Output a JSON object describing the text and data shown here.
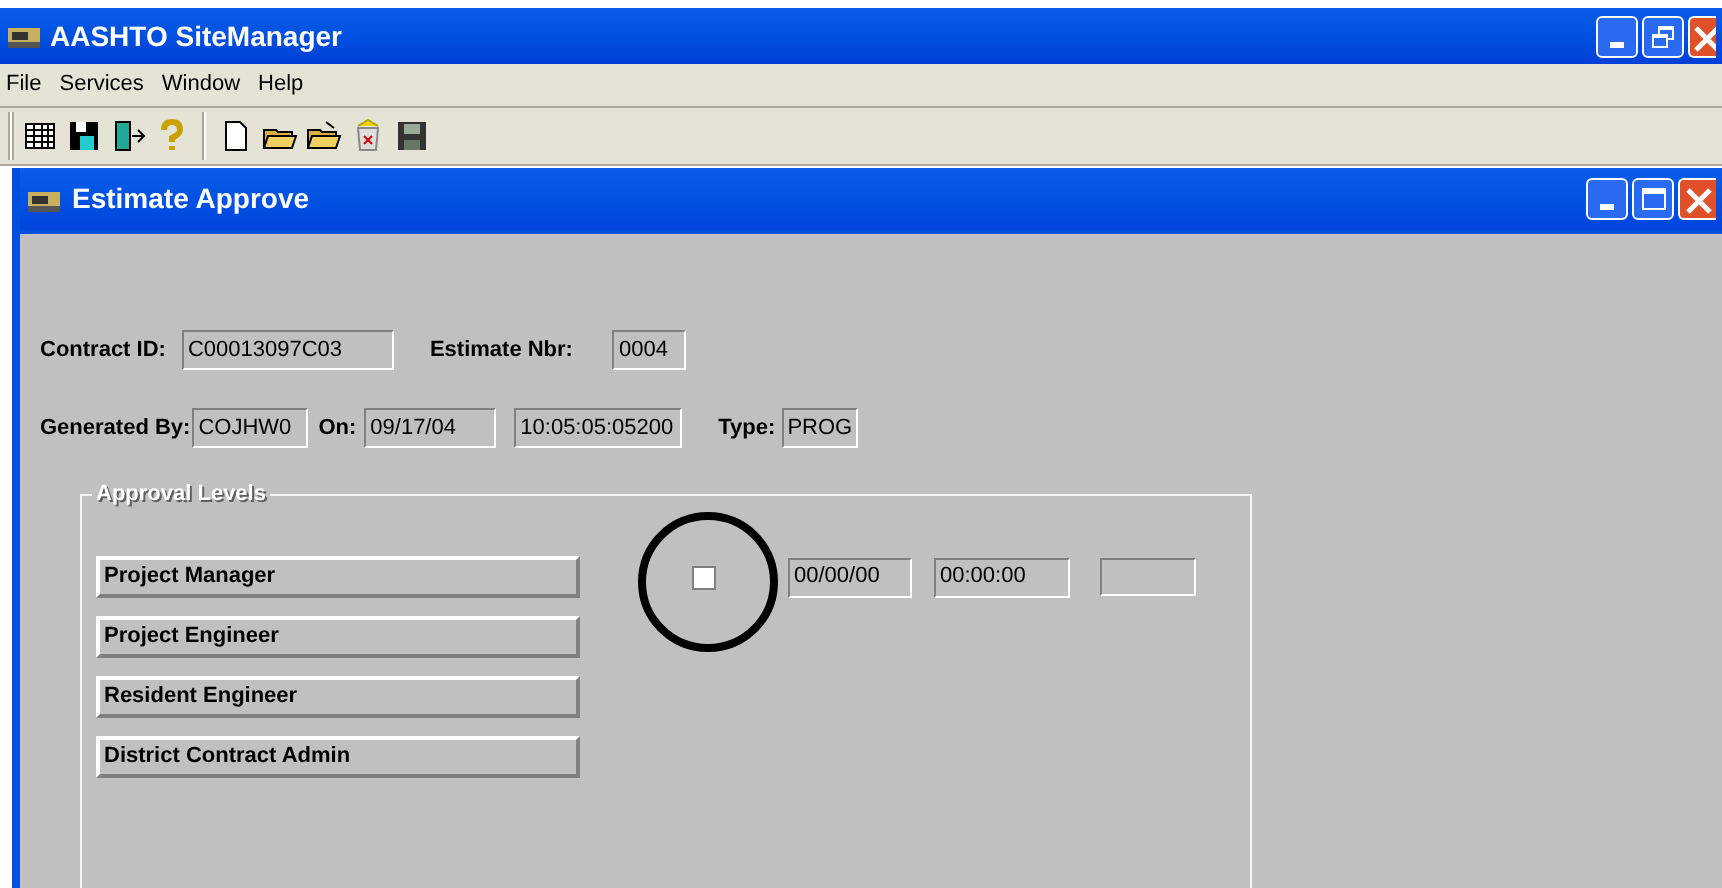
{
  "app_window": {
    "title": "AASHTO SiteManager"
  },
  "menu": [
    "File",
    "Services",
    "Window",
    "Help"
  ],
  "toolbar": [
    {
      "kind": "grid"
    },
    {
      "kind": "disk-person"
    },
    {
      "kind": "exit"
    },
    {
      "kind": "help"
    },
    {
      "kind": "sep"
    },
    {
      "kind": "new"
    },
    {
      "kind": "open"
    },
    {
      "kind": "open2"
    },
    {
      "kind": "trash"
    },
    {
      "kind": "save"
    }
  ],
  "inner_window": {
    "title": "Estimate Approve"
  },
  "form": {
    "contract_id": {
      "label": "Contract ID:",
      "value": "C00013097C03"
    },
    "estimate_nbr": {
      "label": "Estimate Nbr:",
      "value": "0004"
    },
    "generated_by": {
      "label": "Generated By:",
      "value": "COJHW0"
    },
    "on": {
      "label": "On:",
      "date": "09/17/04",
      "time": "10:05:05:05200"
    },
    "type": {
      "label": "Type:",
      "value": "PROG"
    }
  },
  "approval_levels": {
    "title": "Approval Levels",
    "rows": [
      {
        "label": "Project Manager",
        "checked": false,
        "date": "00/00/00",
        "time": "00:00:00"
      },
      {
        "label": "Project Engineer"
      },
      {
        "label": "Resident Engineer"
      },
      {
        "label": "District Contract Admin"
      }
    ]
  }
}
